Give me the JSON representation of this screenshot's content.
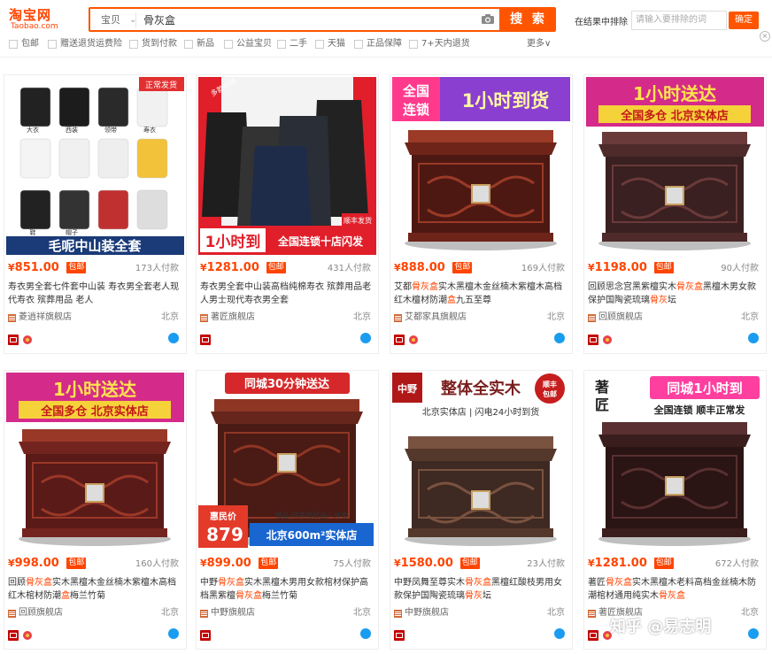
{
  "header": {
    "logo_main": "淘宝网",
    "logo_sub": "Taobao.com",
    "scope_label": "宝贝",
    "query": "骨灰盒",
    "search_label": "搜 索",
    "exclude_label": "在结果中排除",
    "exclude_placeholder": "请输入要排除的词",
    "exclude_confirm": "确定",
    "close_icon": "×"
  },
  "filters": [
    "包邮",
    "赠送退货运费险",
    "货到付款",
    "新品",
    "公益宝贝",
    "二手",
    "天猫",
    "正品保障",
    "7+天内退货"
  ],
  "more_label": "更多∨",
  "colors": {
    "accent": "#ff4400",
    "search": "#ff5500",
    "wangwang": "#1a9cf0"
  },
  "products": [
    {
      "image_lines": [
        "正常发货",
        "大衣",
        "西装",
        "领带",
        "寿衣",
        "鞋",
        "帽子",
        "毛呢中山装全套"
      ],
      "price_symbol": "¥",
      "price": "851.00",
      "baoyou": "包邮",
      "sold": "173人付款",
      "title_parts": [
        "寿衣男全套七件套中山装 寿衣男全套老人现代寿衣 殡葬用品 老人"
      ],
      "shop": "菱逍祥旗舰店",
      "location": "北京",
      "badges": [
        "tmall-icon",
        "flower-icon"
      ]
    },
    {
      "image_lines": [
        "多款可选",
        "顺丰发货",
        "1小时到",
        "全国连锁十店闪发"
      ],
      "price_symbol": "¥",
      "price": "1281.00",
      "baoyou": "包邮",
      "sold": "431人付款",
      "title_parts": [
        "寿衣男全套中山装高档纯棉寿衣 殡葬用品老人男士现代寿衣男全套"
      ],
      "shop": "著匠旗舰店",
      "location": "北京",
      "badges": [
        "tmall-icon"
      ]
    },
    {
      "image_lines": [
        "全国",
        "连锁",
        "1小时到货"
      ],
      "price_symbol": "¥",
      "price": "888.00",
      "baoyou": "包邮",
      "sold": "169人付款",
      "title_parts": [
        "艾都",
        "骨灰盒",
        "实木黑檀木金丝楠木紫檀木高档红木檀材防潮",
        "盒",
        "九五至尊"
      ],
      "shop": "艾都家具旗舰店",
      "location": "北京",
      "badges": [
        "tmall-icon",
        "flower-icon"
      ]
    },
    {
      "image_lines": [
        "1小时送达",
        "全国多仓 北京实体店"
      ],
      "price_symbol": "¥",
      "price": "1198.00",
      "baoyou": "包邮",
      "sold": "90人付款",
      "title_parts": [
        "回顾思念宫黑紫檀实木",
        "骨灰盒",
        "黑檀木男女款保护国陶瓷琉璃",
        "骨灰",
        "坛"
      ],
      "shop": "回顾旗舰店",
      "location": "北京",
      "badges": [
        "tmall-icon",
        "flower-icon"
      ]
    },
    {
      "image_lines": [
        "1小时送达",
        "全国多仓 北京实体店"
      ],
      "price_symbol": "¥",
      "price": "998.00",
      "baoyou": "包邮",
      "sold": "160人付款",
      "title_parts": [
        "回顾",
        "骨灰盒",
        "实木黑檀木金丝楠木紫檀木高档红木棺材防潮",
        "盒",
        "梅兰竹菊"
      ],
      "shop": "回顾旗舰店",
      "location": "北京",
      "badges": [
        "tmall-icon",
        "flower-icon"
      ]
    },
    {
      "image_lines": [
        "同城30分钟送达",
        "惠民价",
        "879",
        "赠品:精美随葬品八件套",
        "北京600m²实体店"
      ],
      "price_symbol": "¥",
      "price": "899.00",
      "baoyou": "包邮",
      "sold": "75人付款",
      "title_parts": [
        "中野",
        "骨灰盒",
        "实木黑檀木男用女款棺材保护高档黑紫檀",
        "骨灰盒",
        "梅兰竹菊"
      ],
      "shop": "中野旗舰店",
      "location": "北京",
      "badges": [
        "tmall-icon"
      ]
    },
    {
      "image_lines": [
        "中野",
        "整体全实木",
        "顺丰包邮",
        "北京实体店 | 闪电24小时到货"
      ],
      "price_symbol": "¥",
      "price": "1580.00",
      "baoyou": "包邮",
      "sold": "23人付款",
      "title_parts": [
        "中野凤舞至尊实木",
        "骨灰盒",
        "黑檀红酸枝男用女款保护国陶瓷琉璃",
        "骨灰",
        "坛"
      ],
      "shop": "中野旗舰店",
      "location": "北京",
      "badges": [
        "tmall-icon"
      ]
    },
    {
      "image_lines": [
        "著",
        "匠",
        "同城1小时到",
        "全国连锁 顺丰正常发"
      ],
      "price_symbol": "¥",
      "price": "1281.00",
      "baoyou": "包邮",
      "sold": "672人付款",
      "title_parts": [
        "著匠",
        "骨灰盒",
        "实木黑檀木老料高档金丝楠木防潮棺材通用纯实木",
        "骨灰盒",
        ""
      ],
      "shop": "著匠旗舰店",
      "location": "北京",
      "badges": [
        "tmall-icon",
        "flower-icon"
      ]
    }
  ],
  "watermark": "知乎 @易志明"
}
